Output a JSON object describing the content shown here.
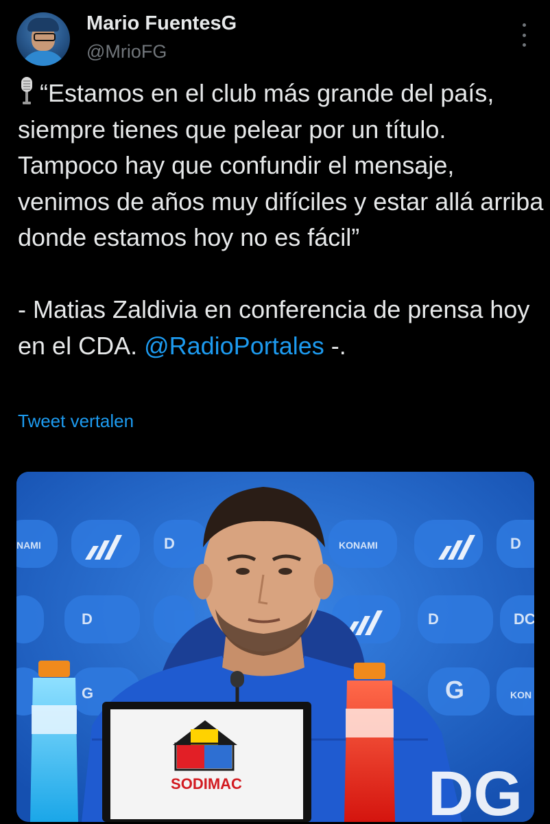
{
  "author": {
    "name": "Mario FuentesG",
    "handle": "@MrioFG"
  },
  "tweet": {
    "quote": "“Estamos en el club más grande del país, siempre tienes que pelear por un título. Tampoco hay que confundir el mensaje, venimos de años muy difíciles y estar allá arriba donde estamos hoy no es fácil”",
    "attribution": "- Matias Zaldivia en conferencia de prensa hoy en el CDA. ",
    "mention": "@RadioPortales",
    "trailing": " -.",
    "translate_label": "Tweet vertalen"
  },
  "media": {
    "sign_text": "SODIMAC"
  },
  "icons": {
    "leading": "microphone-icon",
    "menu": "more-options-icon"
  },
  "colors": {
    "background": "#000000",
    "text": "#e7e9ea",
    "secondary": "#71767b",
    "link": "#1d9bf0"
  }
}
